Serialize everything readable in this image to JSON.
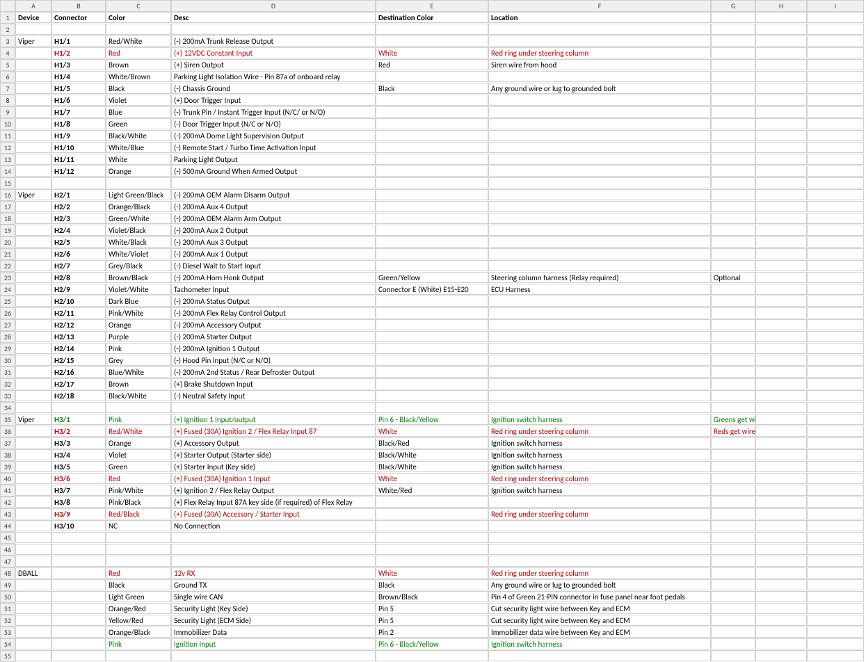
{
  "columns": [
    "A",
    "B",
    "C",
    "D",
    "E",
    "F",
    "G",
    "H",
    "I"
  ],
  "totalRows": 55,
  "headerRow": {
    "A": "Device",
    "B": "Connector",
    "C": "Color",
    "D": "Desc",
    "E": "Destination Color",
    "F": "Location",
    "G": "",
    "H": "",
    "I": ""
  },
  "rows": [
    {
      "n": 1,
      "bold": true,
      "cells": {
        "A": "Device",
        "B": "Connector",
        "C": "Color",
        "D": "Desc",
        "E": "Destination Color",
        "F": "Location"
      }
    },
    {
      "n": 2,
      "cells": {}
    },
    {
      "n": 3,
      "cells": {
        "A": "Viper",
        "B": {
          "t": "H1/1",
          "b": true
        },
        "C": "Red/White",
        "D": "(-) 200mA Trunk Release Output"
      }
    },
    {
      "n": 4,
      "color": "red",
      "cells": {
        "B": {
          "t": "H1/2",
          "b": true
        },
        "C": "Red",
        "D": "(+) 12VDC Constant Input",
        "E": "White",
        "F": "Red ring under steering column"
      }
    },
    {
      "n": 5,
      "cells": {
        "B": {
          "t": "H1/3",
          "b": true
        },
        "C": "Brown",
        "D": "(+) Siren Output",
        "E": "Red",
        "F": "Siren wire from hood"
      }
    },
    {
      "n": 6,
      "cells": {
        "B": {
          "t": "H1/4",
          "b": true
        },
        "C": "White/Brown",
        "D": "Parking Light Isolation Wire - Pin 87a of onboard relay"
      }
    },
    {
      "n": 7,
      "cells": {
        "B": {
          "t": "H1/5",
          "b": true
        },
        "C": "Black",
        "D": "(-) Chassis Ground",
        "E": "Black",
        "F": "Any ground wire or lug to grounded bolt"
      }
    },
    {
      "n": 8,
      "cells": {
        "B": {
          "t": "H1/6",
          "b": true
        },
        "C": "Violet",
        "D": "(+) Door Trigger Input"
      }
    },
    {
      "n": 9,
      "cells": {
        "B": {
          "t": "H1/7",
          "b": true
        },
        "C": "Blue",
        "D": "(-) Trunk Pin / Instant Trigger Input (N/C/ or N/O)"
      }
    },
    {
      "n": 10,
      "cells": {
        "B": {
          "t": "H1/8",
          "b": true
        },
        "C": "Green",
        "D": "(-) Door Trigger Input (N/C or N/O)"
      }
    },
    {
      "n": 11,
      "cells": {
        "B": {
          "t": "H1/9",
          "b": true
        },
        "C": "Black/White",
        "D": "(-) 200mA Dome Light Supervision Output"
      }
    },
    {
      "n": 12,
      "cells": {
        "B": {
          "t": "H1/10",
          "b": true
        },
        "C": "White/Blue",
        "D": "(-) Remote Start / Turbo Time Activation Input"
      }
    },
    {
      "n": 13,
      "cells": {
        "B": {
          "t": "H1/11",
          "b": true
        },
        "C": "White",
        "D": "Parking Light Output"
      }
    },
    {
      "n": 14,
      "cells": {
        "B": {
          "t": "H1/12",
          "b": true
        },
        "C": "Orange",
        "D": "(-) 500mA Ground When Armed Output"
      }
    },
    {
      "n": 15,
      "cells": {}
    },
    {
      "n": 16,
      "cells": {
        "A": "Viper",
        "B": {
          "t": "H2/1",
          "b": true
        },
        "C": "Light Green/Black",
        "D": "(-) 200mA OEM Alarm Disarm Output"
      }
    },
    {
      "n": 17,
      "cells": {
        "B": {
          "t": "H2/2",
          "b": true
        },
        "C": "Orange/Black",
        "D": "(-) 200mA Aux 4 Output"
      }
    },
    {
      "n": 18,
      "cells": {
        "B": {
          "t": "H2/3",
          "b": true
        },
        "C": "Green/White",
        "D": "(-) 200mA OEM Alarm Arm Output"
      }
    },
    {
      "n": 19,
      "cells": {
        "B": {
          "t": "H2/4",
          "b": true
        },
        "C": "Violet/Black",
        "D": "(-) 200mA Aux 2 Output"
      }
    },
    {
      "n": 20,
      "cells": {
        "B": {
          "t": "H2/5",
          "b": true
        },
        "C": "White/Black",
        "D": "(-) 200mA Aux 3 Output"
      }
    },
    {
      "n": 21,
      "cells": {
        "B": {
          "t": "H2/6",
          "b": true
        },
        "C": "White/Violet",
        "D": "(-) 200mA Aux 1 Output"
      }
    },
    {
      "n": 22,
      "cells": {
        "B": {
          "t": "H2/7",
          "b": true
        },
        "C": "Grey/Black",
        "D": "(-) Diesel Wait to Start Input"
      }
    },
    {
      "n": 23,
      "cells": {
        "B": {
          "t": "H2/8",
          "b": true
        },
        "C": "Brown/Black",
        "D": "(-) 200mA Horn Honk Output",
        "E": "Green/Yellow",
        "F": "Steering column harness (Relay required)",
        "G": "Optional"
      }
    },
    {
      "n": 24,
      "cells": {
        "B": {
          "t": "H2/9",
          "b": true
        },
        "C": "Violet/White",
        "D": "Tachometer Input",
        "E": "Connector E (White) E15-E20",
        "F": "ECU Harness"
      }
    },
    {
      "n": 25,
      "cells": {
        "B": {
          "t": "H2/10",
          "b": true
        },
        "C": "Dark Blue",
        "D": "(-) 200mA Status Output"
      }
    },
    {
      "n": 26,
      "cells": {
        "B": {
          "t": "H2/11",
          "b": true
        },
        "C": "Pink/White",
        "D": "(-) 200mA Flex Relay Control Output"
      }
    },
    {
      "n": 27,
      "cells": {
        "B": {
          "t": "H2/12",
          "b": true
        },
        "C": "Orange",
        "D": "(-) 200mA Accessory Output"
      }
    },
    {
      "n": 28,
      "cells": {
        "B": {
          "t": "H2/13",
          "b": true
        },
        "C": "Purple",
        "D": "(-) 200mA Starter Output"
      }
    },
    {
      "n": 29,
      "cells": {
        "B": {
          "t": "H2/14",
          "b": true
        },
        "C": "Pink",
        "D": "(-) 200mA Ignition 1 Output"
      }
    },
    {
      "n": 30,
      "cells": {
        "B": {
          "t": "H2/15",
          "b": true
        },
        "C": "Grey",
        "D": "(-) Hood Pin Input (N/C or N/O)"
      }
    },
    {
      "n": 31,
      "cells": {
        "B": {
          "t": "H2/16",
          "b": true
        },
        "C": "Blue/White",
        "D": "(-) 200mA 2nd Status / Rear Defroster Output"
      }
    },
    {
      "n": 32,
      "cells": {
        "B": {
          "t": "H2/17",
          "b": true
        },
        "C": "Brown",
        "D": "(+) Brake Shutdown Input"
      }
    },
    {
      "n": 33,
      "cells": {
        "B": {
          "t": "H2/18",
          "b": true
        },
        "C": "Black/White",
        "D": "(-) Neutral Safety Input"
      }
    },
    {
      "n": 34,
      "cells": {}
    },
    {
      "n": 35,
      "color": "green",
      "cells": {
        "A": {
          "t": "Viper",
          "c": ""
        },
        "B": {
          "t": "H3/1",
          "b": true
        },
        "C": "Pink",
        "D": "(+) Ignition 1 Input/output",
        "E": "Pin 6 - Black/Yellow",
        "F": "Ignition switch harness",
        "G": "Greens get wired together"
      }
    },
    {
      "n": 36,
      "color": "red",
      "cells": {
        "B": {
          "t": "H3/2",
          "b": true
        },
        "C": "Red/White",
        "D": "(+) Fused (30A) Ignition 2 / Flex Relay Input 87",
        "E": "White",
        "F": "Red ring under steering column",
        "G": "Reds get wired together"
      }
    },
    {
      "n": 37,
      "cells": {
        "B": {
          "t": "H3/3",
          "b": true
        },
        "C": "Orange",
        "D": "(+) Accessory Output",
        "E": "Black/Red",
        "F": "Ignition switch harness"
      }
    },
    {
      "n": 38,
      "cells": {
        "B": {
          "t": "H3/4",
          "b": true
        },
        "C": "Violet",
        "D": "(+) Starter Output (Starter side)",
        "E": "Black/White",
        "F": "Ignition switch harness"
      }
    },
    {
      "n": 39,
      "cells": {
        "B": {
          "t": "H3/5",
          "b": true
        },
        "C": "Green",
        "D": "(+) Starter Input (Key side)",
        "E": "Black/White",
        "F": "Ignition switch harness"
      }
    },
    {
      "n": 40,
      "color": "red",
      "cells": {
        "B": {
          "t": "H3/6",
          "b": true
        },
        "C": "Red",
        "D": "(+) Fused (30A) Ignition 1 Input",
        "E": "White",
        "F": "Red ring under steering column"
      }
    },
    {
      "n": 41,
      "cells": {
        "B": {
          "t": "H3/7",
          "b": true
        },
        "C": "Pink/White",
        "D": "(+) Ignition 2 / Flex Relay Output",
        "E": "White/Red",
        "F": "Ignition switch harness"
      }
    },
    {
      "n": 42,
      "cells": {
        "B": {
          "t": "H3/8",
          "b": true
        },
        "C": "Pink/Black",
        "D": "(+) Flex Relay Input 87A key side (if required) of Flex Relay"
      }
    },
    {
      "n": 43,
      "color": "red",
      "cells": {
        "B": {
          "t": "H3/9",
          "b": true
        },
        "C": "Red/Black",
        "D": "(+) Fused (30A) Accessory / Starter Input",
        "F": "Red ring under steering column"
      }
    },
    {
      "n": 44,
      "cells": {
        "B": {
          "t": "H3/10",
          "b": true
        },
        "C": "NC",
        "D": "No Connection"
      }
    },
    {
      "n": 45,
      "cells": {}
    },
    {
      "n": 46,
      "cells": {}
    },
    {
      "n": 47,
      "cells": {}
    },
    {
      "n": 48,
      "color": "red",
      "cells": {
        "A": {
          "t": "DBALL",
          "c": ""
        },
        "C": "Red",
        "D": "12v RX",
        "E": "White",
        "F": "Red ring under steering column"
      }
    },
    {
      "n": 49,
      "cells": {
        "C": "Black",
        "D": "Ground TX",
        "E": "Black",
        "F": "Any ground wire or lug to grounded bolt"
      }
    },
    {
      "n": 50,
      "cells": {
        "C": "Light Green",
        "D": "Single wire CAN",
        "E": "Brown/Black",
        "F": "Pin 4 of Green 21-PIN connector in fuse panel near foot pedals"
      }
    },
    {
      "n": 51,
      "cells": {
        "C": "Orange/Red",
        "D": "Security Light (Key Side)",
        "E": "Pin 5",
        "F": "Cut security light wire between Key and ECM"
      }
    },
    {
      "n": 52,
      "cells": {
        "C": "Yellow/Red",
        "D": "Security Light (ECM Side)",
        "E": "Pin 5",
        "F": "Cut security light wire between Key and ECM"
      }
    },
    {
      "n": 53,
      "cells": {
        "C": "Orange/Black",
        "D": "Immobilizer Data",
        "E": "Pin 2",
        "F": "Immobilizer data wire between Key and ECM"
      }
    },
    {
      "n": 54,
      "color": "green",
      "cells": {
        "C": "Pink",
        "D": "Ignition Input",
        "E": "Pin 6 - Black/Yellow",
        "F": "Ignition switch harness"
      }
    },
    {
      "n": 55,
      "cells": {}
    }
  ]
}
